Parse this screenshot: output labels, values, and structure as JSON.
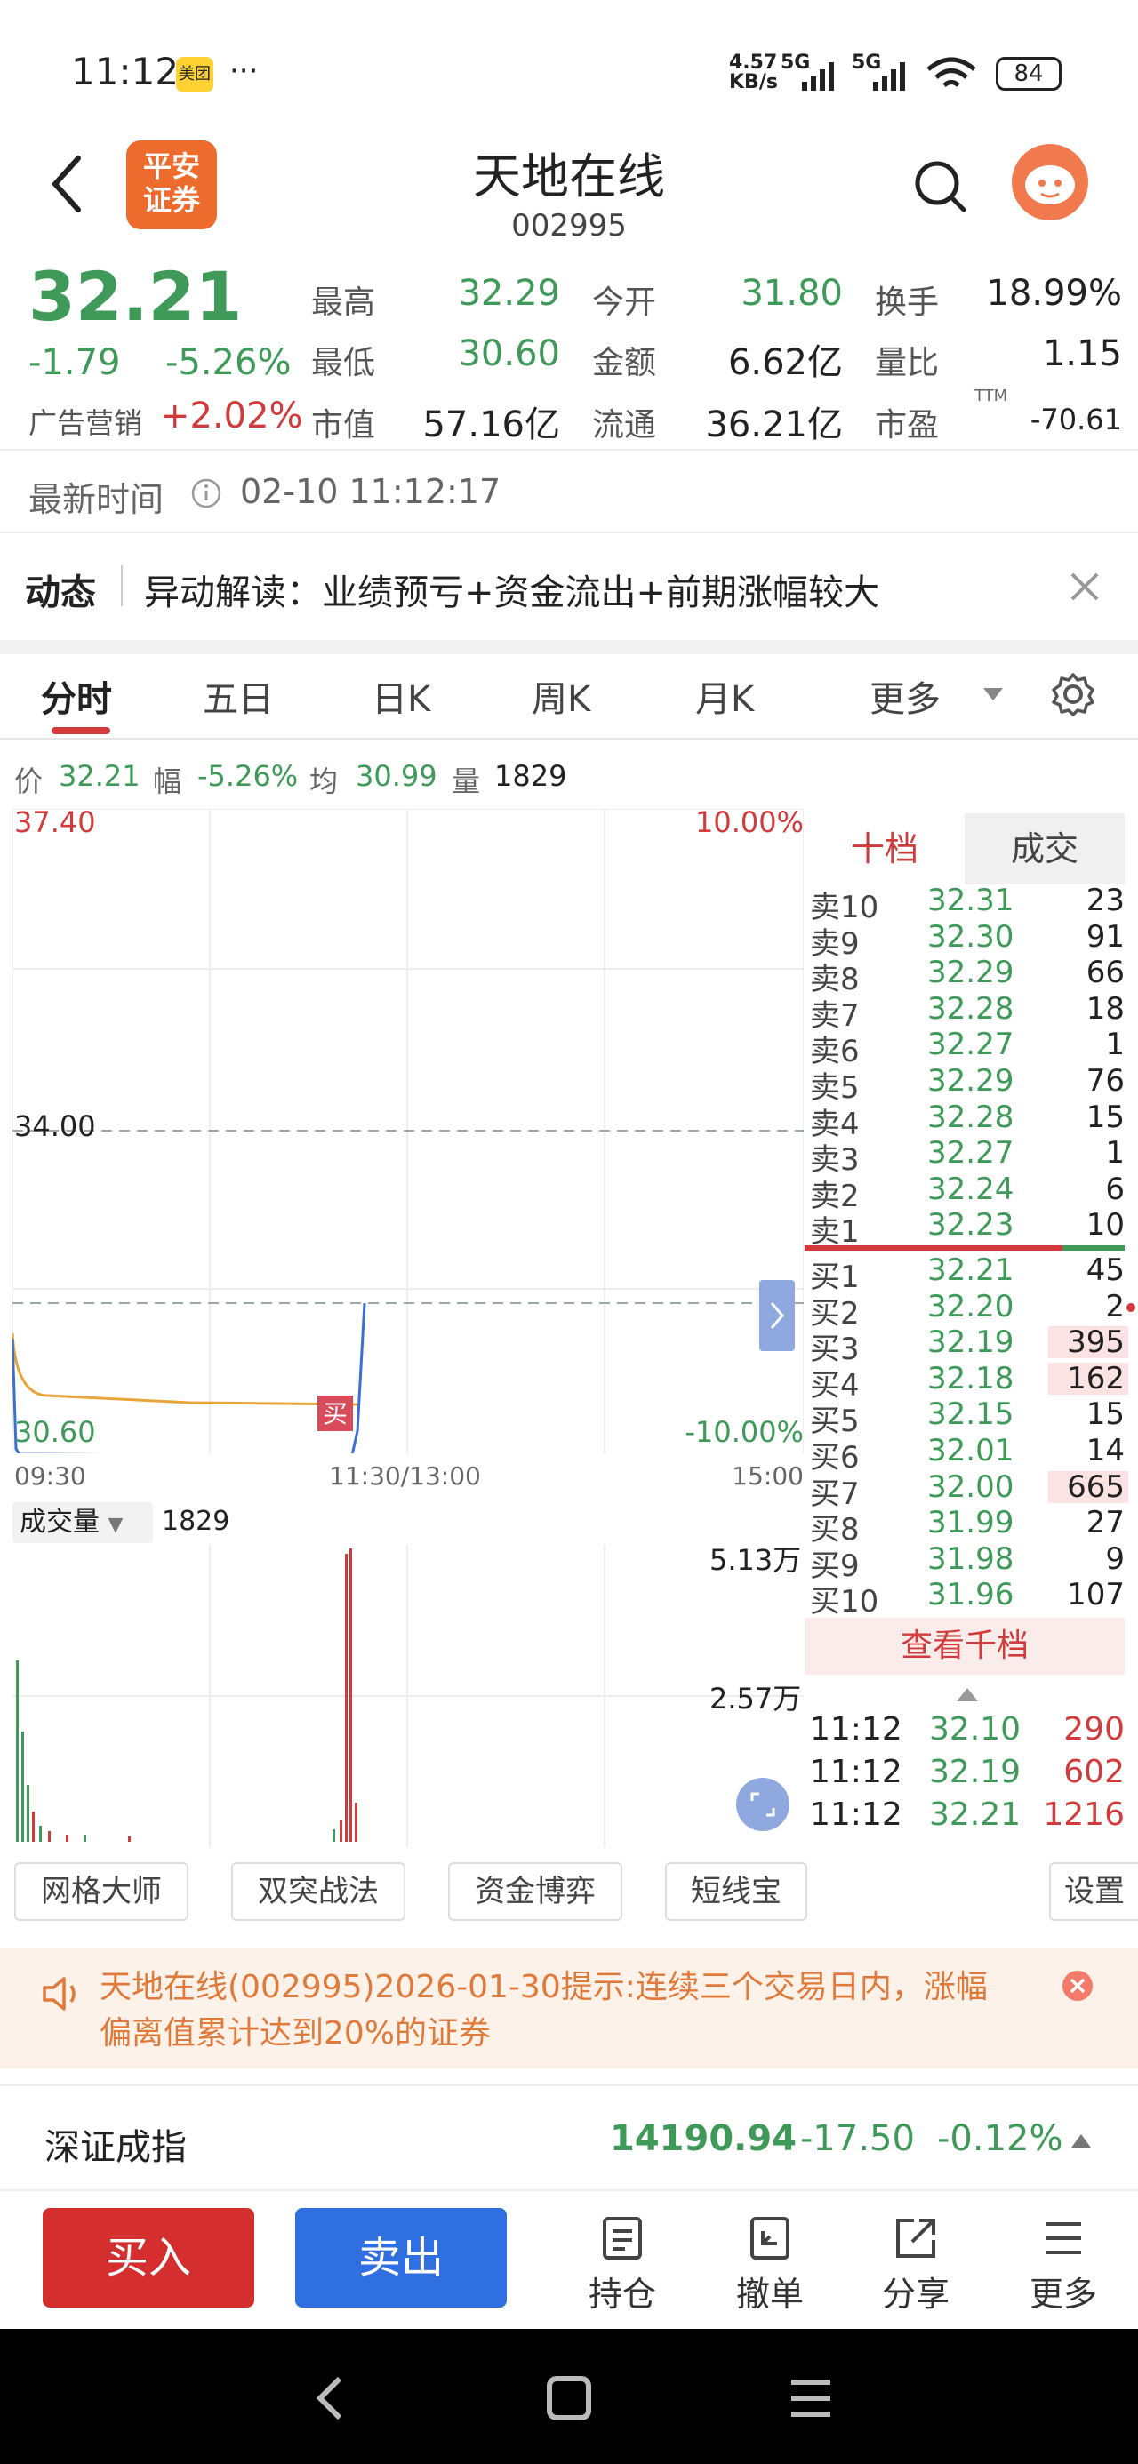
{
  "status": {
    "time": "11:12",
    "app_badge": "美团",
    "dots": "···",
    "net_speed": "4.57\nKB/s",
    "sig1": "5G",
    "sig2": "5G",
    "battery": "84"
  },
  "header": {
    "logo_line1": "平安",
    "logo_line2": "证券",
    "title": "天地在线",
    "code": "002995"
  },
  "quote": {
    "price": "32.21",
    "change": "-1.79",
    "change_pct": "-5.26%",
    "sector_name": "广告营销",
    "sector_pct": "+2.02%",
    "fields": [
      {
        "label": "最高",
        "value": "32.29",
        "color": "g"
      },
      {
        "label": "今开",
        "value": "31.80",
        "color": "g"
      },
      {
        "label": "换手",
        "value": "18.99%",
        "color": "dk"
      },
      {
        "label": "最低",
        "value": "30.60",
        "color": "g"
      },
      {
        "label": "金额",
        "value": "6.62亿",
        "color": "dk"
      },
      {
        "label": "量比",
        "value": "1.15",
        "color": "dk"
      },
      {
        "label": "市值",
        "value": "57.16亿",
        "color": "dk"
      },
      {
        "label": "流通",
        "value": "36.21亿",
        "color": "dk"
      },
      {
        "label": "市盈",
        "value": "-70.61",
        "color": "dk",
        "sup": "TTM"
      }
    ]
  },
  "timebar": {
    "label": "最新时间",
    "value": "02-10 11:12:17"
  },
  "news": {
    "tag": "动态",
    "text": "异动解读：业绩预亏+资金流出+前期涨幅较大"
  },
  "tabs": [
    "分时",
    "五日",
    "日K",
    "周K",
    "月K",
    "更多"
  ],
  "infoline": {
    "price_label": "价",
    "price": "32.21",
    "amp_label": "幅",
    "amp": "-5.26%",
    "avg_label": "均",
    "avg": "30.99",
    "vol_label": "量",
    "vol": "1829"
  },
  "chart": {
    "y_top": "37.40",
    "pct_top": "10.00%",
    "y_mid": "34.00",
    "y_bot": "30.60",
    "pct_bot": "-10.00%",
    "t_start": "09:30",
    "t_mid": "11:30/13:00",
    "t_end": "15:00",
    "buy_marker": "买",
    "vol_dropdown": "成交量",
    "vol_value": "1829",
    "vol_max": "5.13万",
    "vol_half": "2.57万"
  },
  "chart_data": {
    "type": "line",
    "title": "",
    "x": [
      "09:30",
      "11:30/13:00",
      "15:00"
    ],
    "ylim": [
      30.6,
      37.4
    ],
    "series": [
      {
        "name": "价",
        "values": [
          32.21
        ]
      },
      {
        "name": "均",
        "values": [
          30.99
        ]
      }
    ]
  },
  "orderbook": {
    "tab_active": "十档",
    "tab_other": "成交",
    "asks": [
      {
        "n": "卖10",
        "p": "32.31",
        "q": "23"
      },
      {
        "n": "卖9",
        "p": "32.30",
        "q": "91"
      },
      {
        "n": "卖8",
        "p": "32.29",
        "q": "66"
      },
      {
        "n": "卖7",
        "p": "32.28",
        "q": "18"
      },
      {
        "n": "卖6",
        "p": "32.27",
        "q": "1"
      },
      {
        "n": "卖5",
        "p": "32.29",
        "q": "76"
      },
      {
        "n": "卖4",
        "p": "32.28",
        "q": "15"
      },
      {
        "n": "卖3",
        "p": "32.27",
        "q": "1"
      },
      {
        "n": "卖2",
        "p": "32.24",
        "q": "6"
      },
      {
        "n": "卖1",
        "p": "32.23",
        "q": "10"
      }
    ],
    "bids": [
      {
        "n": "买1",
        "p": "32.21",
        "q": "45"
      },
      {
        "n": "买2",
        "p": "32.20",
        "q": "2"
      },
      {
        "n": "买3",
        "p": "32.19",
        "q": "395"
      },
      {
        "n": "买4",
        "p": "32.18",
        "q": "162"
      },
      {
        "n": "买5",
        "p": "32.15",
        "q": "15"
      },
      {
        "n": "买6",
        "p": "32.01",
        "q": "14"
      },
      {
        "n": "买7",
        "p": "32.00",
        "q": "665"
      },
      {
        "n": "买8",
        "p": "31.99",
        "q": "27"
      },
      {
        "n": "买9",
        "p": "31.98",
        "q": "9"
      },
      {
        "n": "买10",
        "p": "31.96",
        "q": "107"
      }
    ],
    "view_more": "查看千档",
    "trades": [
      {
        "t": "11:12",
        "p": "32.10",
        "q": "290"
      },
      {
        "t": "11:12",
        "p": "32.19",
        "q": "602"
      },
      {
        "t": "11:12",
        "p": "32.21",
        "q": "1216"
      }
    ]
  },
  "tools": [
    "网格大师",
    "双突战法",
    "资金博弈",
    "短线宝"
  ],
  "settings": "设置",
  "alert": {
    "text": "天地在线(002995)2026-01-30提示:连续三个交易日内，涨幅偏离值累计达到20%的证券"
  },
  "index": {
    "name": "深证成指",
    "value": "14190.94",
    "change": "-17.50",
    "pct": "-0.12%"
  },
  "actions": {
    "buy": "买入",
    "sell": "卖出",
    "items": [
      "持仓",
      "撤单",
      "分享",
      "更多"
    ]
  }
}
